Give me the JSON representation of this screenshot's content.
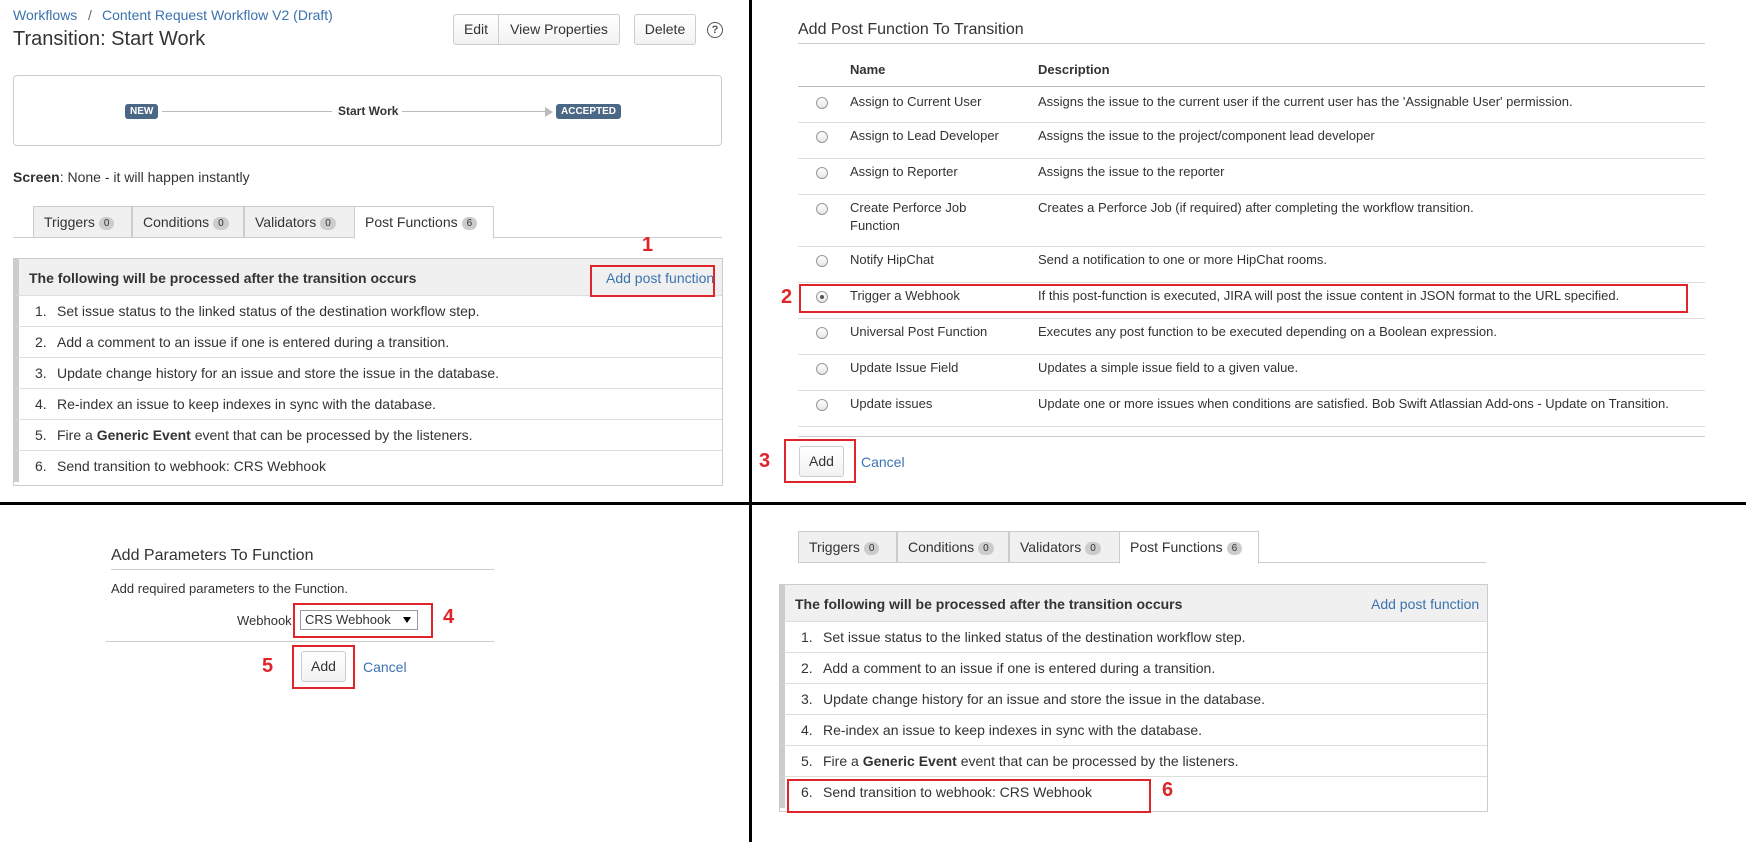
{
  "breadcrumb": {
    "workflows": "Workflows",
    "separator": "/",
    "workflow": "Content Request Workflow V2 (Draft)"
  },
  "page_title": "Transition: Start Work",
  "toolbar": {
    "edit": "Edit",
    "view_properties": "View Properties",
    "delete": "Delete",
    "help_icon": "?"
  },
  "diagram": {
    "from_status": "NEW",
    "transition": "Start Work",
    "to_status": "ACCEPTED"
  },
  "screen": {
    "label": "Screen",
    "value": ": None - it will happen instantly"
  },
  "tabs": [
    {
      "label": "Triggers",
      "count": "0"
    },
    {
      "label": "Conditions",
      "count": "0"
    },
    {
      "label": "Validators",
      "count": "0"
    },
    {
      "label": "Post Functions",
      "count": "6"
    }
  ],
  "post_functions": {
    "heading": "The following will be processed after the transition occurs",
    "add_link": "Add post function",
    "items": [
      {
        "num": "1.",
        "text": "Set issue status to the linked status of the destination workflow step."
      },
      {
        "num": "2.",
        "text": "Add a comment to an issue if one is entered during a transition."
      },
      {
        "num": "3.",
        "text": "Update change history for an issue and store the issue in the database."
      },
      {
        "num": "4.",
        "text": "Re-index an issue to keep indexes in sync with the database."
      },
      {
        "num": "5.",
        "pre": "Fire a ",
        "bold": "Generic Event",
        "post": " event that can be processed by the listeners."
      },
      {
        "num": "6.",
        "text": "Send transition to webhook: CRS Webhook"
      }
    ]
  },
  "add_post_function": {
    "title": "Add Post Function To Transition",
    "col_name": "Name",
    "col_desc": "Description",
    "functions": [
      {
        "name": "Assign to Current User",
        "desc": "Assigns the issue to the current user if the current user has the 'Assignable User' permission.",
        "selected": false
      },
      {
        "name": "Assign to Lead Developer",
        "desc": "Assigns the issue to the project/component lead developer",
        "selected": false
      },
      {
        "name": "Assign to Reporter",
        "desc": "Assigns the issue to the reporter",
        "selected": false
      },
      {
        "name": "Create Perforce Job Function",
        "desc": "Creates a Perforce Job (if required) after completing the workflow transition.",
        "selected": false
      },
      {
        "name": "Notify HipChat",
        "desc": "Send a notification to one or more HipChat rooms.",
        "selected": false
      },
      {
        "name": "Trigger a Webhook",
        "desc": "If this post-function is executed, JIRA will post the issue content in JSON format to the URL specified.",
        "selected": true
      },
      {
        "name": "Universal Post Function",
        "desc": "Executes any post function to be executed depending on a Boolean expression.",
        "selected": false
      },
      {
        "name": "Update Issue Field",
        "desc": "Updates a simple issue field to a given value.",
        "selected": false
      },
      {
        "name": "Update issues",
        "desc": "Update one or more issues when conditions are satisfied. Bob Swift Atlassian Add-ons - Update on Transition.",
        "selected": false
      }
    ],
    "add": "Add",
    "cancel": "Cancel"
  },
  "add_parameters": {
    "title": "Add Parameters To Function",
    "description": "Add required parameters to the Function.",
    "webhook_label": "Webhook",
    "webhook_value": "CRS Webhook",
    "add": "Add",
    "cancel": "Cancel"
  },
  "step_markers": [
    "1",
    "2",
    "3",
    "4",
    "5",
    "6"
  ],
  "colors": {
    "link": "#3b73af",
    "marker": "#e0252a",
    "status_lozenge": "#4a6785"
  }
}
